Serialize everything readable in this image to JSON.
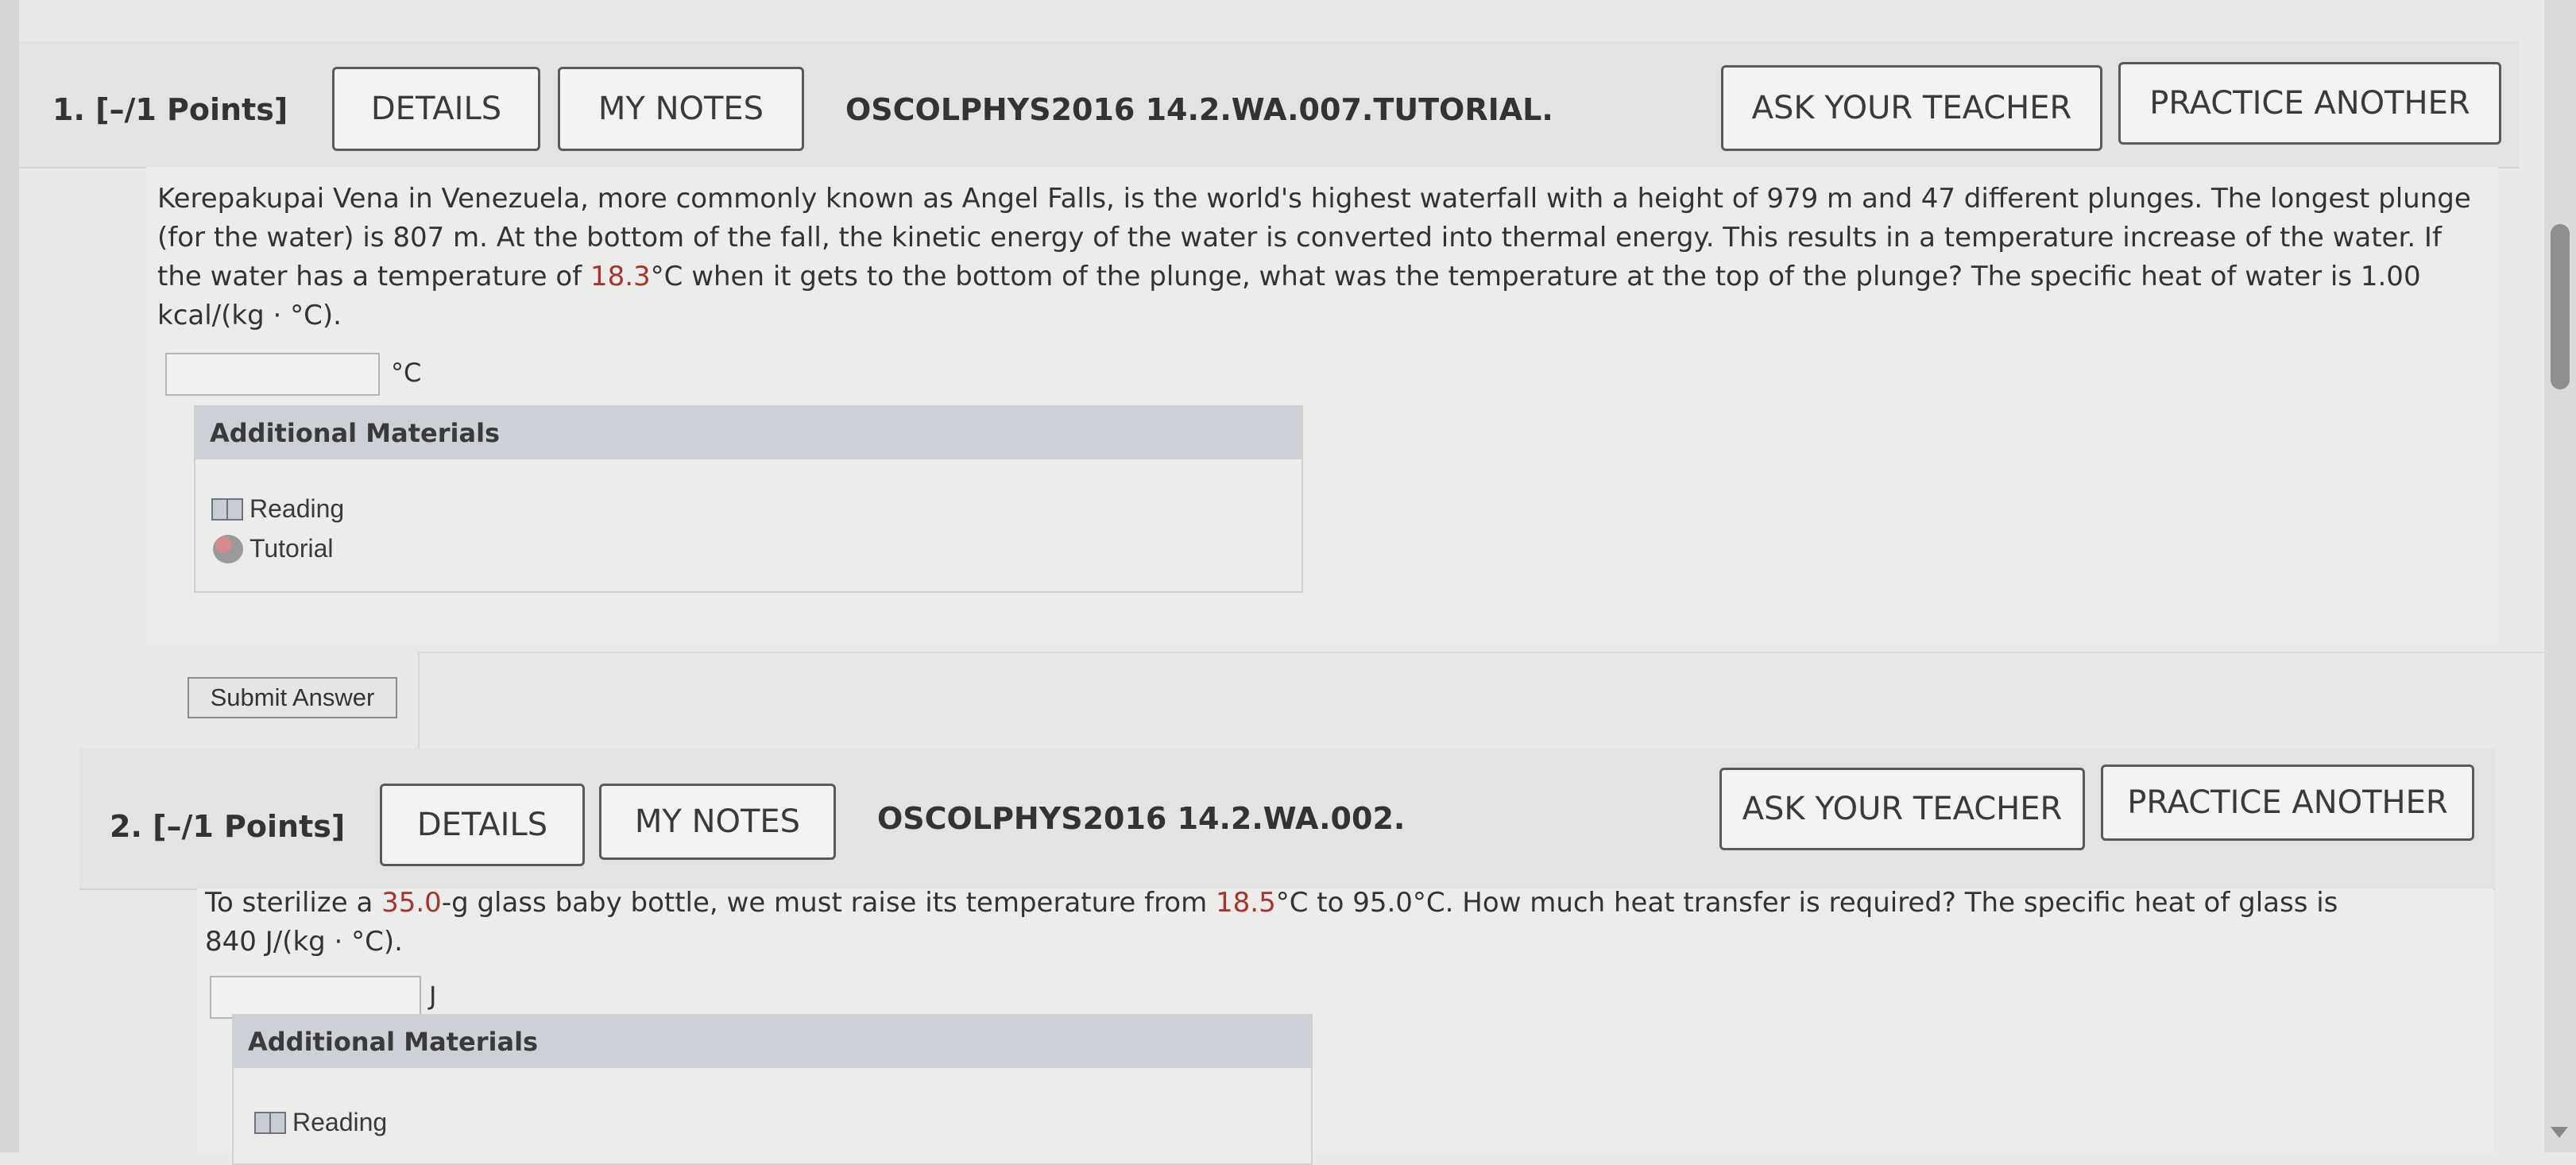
{
  "questions": [
    {
      "number": "1.",
      "points": "[–/1 Points]",
      "details_label": "DETAILS",
      "notes_label": "MY NOTES",
      "code": "OSCOLPHYS2016 14.2.WA.007.TUTORIAL.",
      "ask_label": "ASK YOUR TEACHER",
      "practice_label": "PRACTICE ANOTHER",
      "prompt": {
        "line1": "Kerepakupai Vena in Venezuela, more commonly known as Angel Falls, is the world's highest waterfall with a height of 979 m and 47 different plunges. The longest plunge",
        "line2": "(for the water) is 807 m. At the bottom of the fall, the kinetic energy of the water is converted into thermal energy. This results in a temperature increase of the water. If",
        "line3_pre": "the water has a temperature of ",
        "line3_hl": "18.3",
        "line3_post": "°C when it gets to the bottom of the plunge, what was the temperature at the top of the plunge? The specific heat of water is 1.00",
        "line4": "kcal/(kg · °C)."
      },
      "answer_value": "",
      "unit": "°C",
      "additional_materials_title": "Additional Materials",
      "materials": [
        {
          "label": "Reading",
          "icon": "book-icon"
        },
        {
          "label": "Tutorial",
          "icon": "tutorial-icon"
        }
      ],
      "submit_label": "Submit Answer"
    },
    {
      "number": "2.",
      "points": "[–/1 Points]",
      "details_label": "DETAILS",
      "notes_label": "MY NOTES",
      "code": "OSCOLPHYS2016 14.2.WA.002.",
      "ask_label": "ASK YOUR TEACHER",
      "practice_label": "PRACTICE ANOTHER",
      "prompt": {
        "line1_pre": "To sterilize a ",
        "line1_hl1": "35.0",
        "line1_mid": "-g glass baby bottle, we must raise its temperature from ",
        "line1_hl2": "18.5",
        "line1_post": "°C to 95.0°C. How much heat transfer is required? The specific heat of glass is",
        "line2": "840 J/(kg · °C)."
      },
      "answer_value": "",
      "unit": "J",
      "additional_materials_title": "Additional Materials",
      "materials": [
        {
          "label": "Reading",
          "icon": "book-icon"
        }
      ]
    }
  ],
  "colors": {
    "highlight": "#a5362b",
    "header_bg": "#e3e3e1",
    "materials_header": "#cdd0d6"
  }
}
